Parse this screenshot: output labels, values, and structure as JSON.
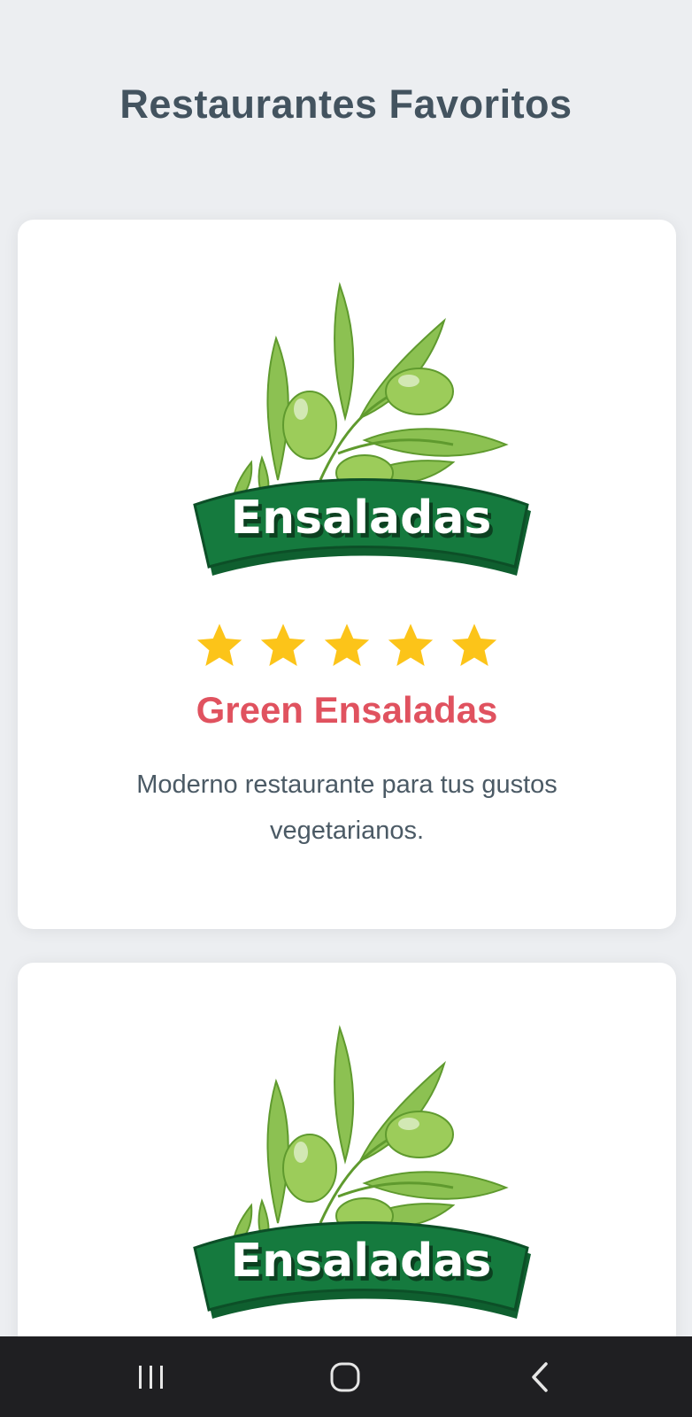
{
  "header": {
    "title": "Restaurantes Favoritos"
  },
  "restaurants": [
    {
      "logo_text": "Ensaladas",
      "rating": 5,
      "rating_max": 5,
      "name": "Green Ensaladas",
      "description": "Moderno restaurante para tus gustos vegetarianos."
    },
    {
      "logo_text": "Ensaladas"
    }
  ],
  "colors": {
    "background": "#eceef1",
    "card": "#ffffff",
    "title": "#43535f",
    "name_accent": "#e0525f",
    "star": "#fcc419",
    "leaf": "#8cc152",
    "banner": "#157a3e",
    "nav_bar": "#1f1f22"
  },
  "nav": {
    "recent_icon": "recent-apps-icon",
    "home_icon": "home-icon",
    "back_icon": "back-icon"
  }
}
